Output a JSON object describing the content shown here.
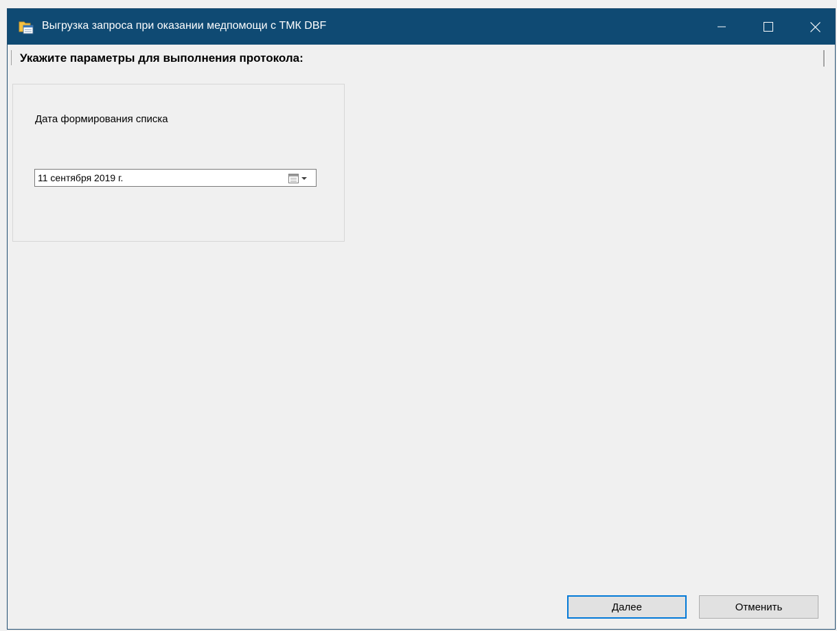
{
  "window": {
    "title": "Выгрузка запроса при оказании медпомощи с ТМК DBF",
    "icon": "folder-form-icon",
    "accent_color": "#0f4a73"
  },
  "form": {
    "heading": "Укажите параметры для выполнения протокола:",
    "date_field": {
      "label": "Дата формирования списка",
      "value": "11 сентября 2019 г."
    }
  },
  "buttons": {
    "next_label": "Далее",
    "cancel_label": "Отменить"
  }
}
